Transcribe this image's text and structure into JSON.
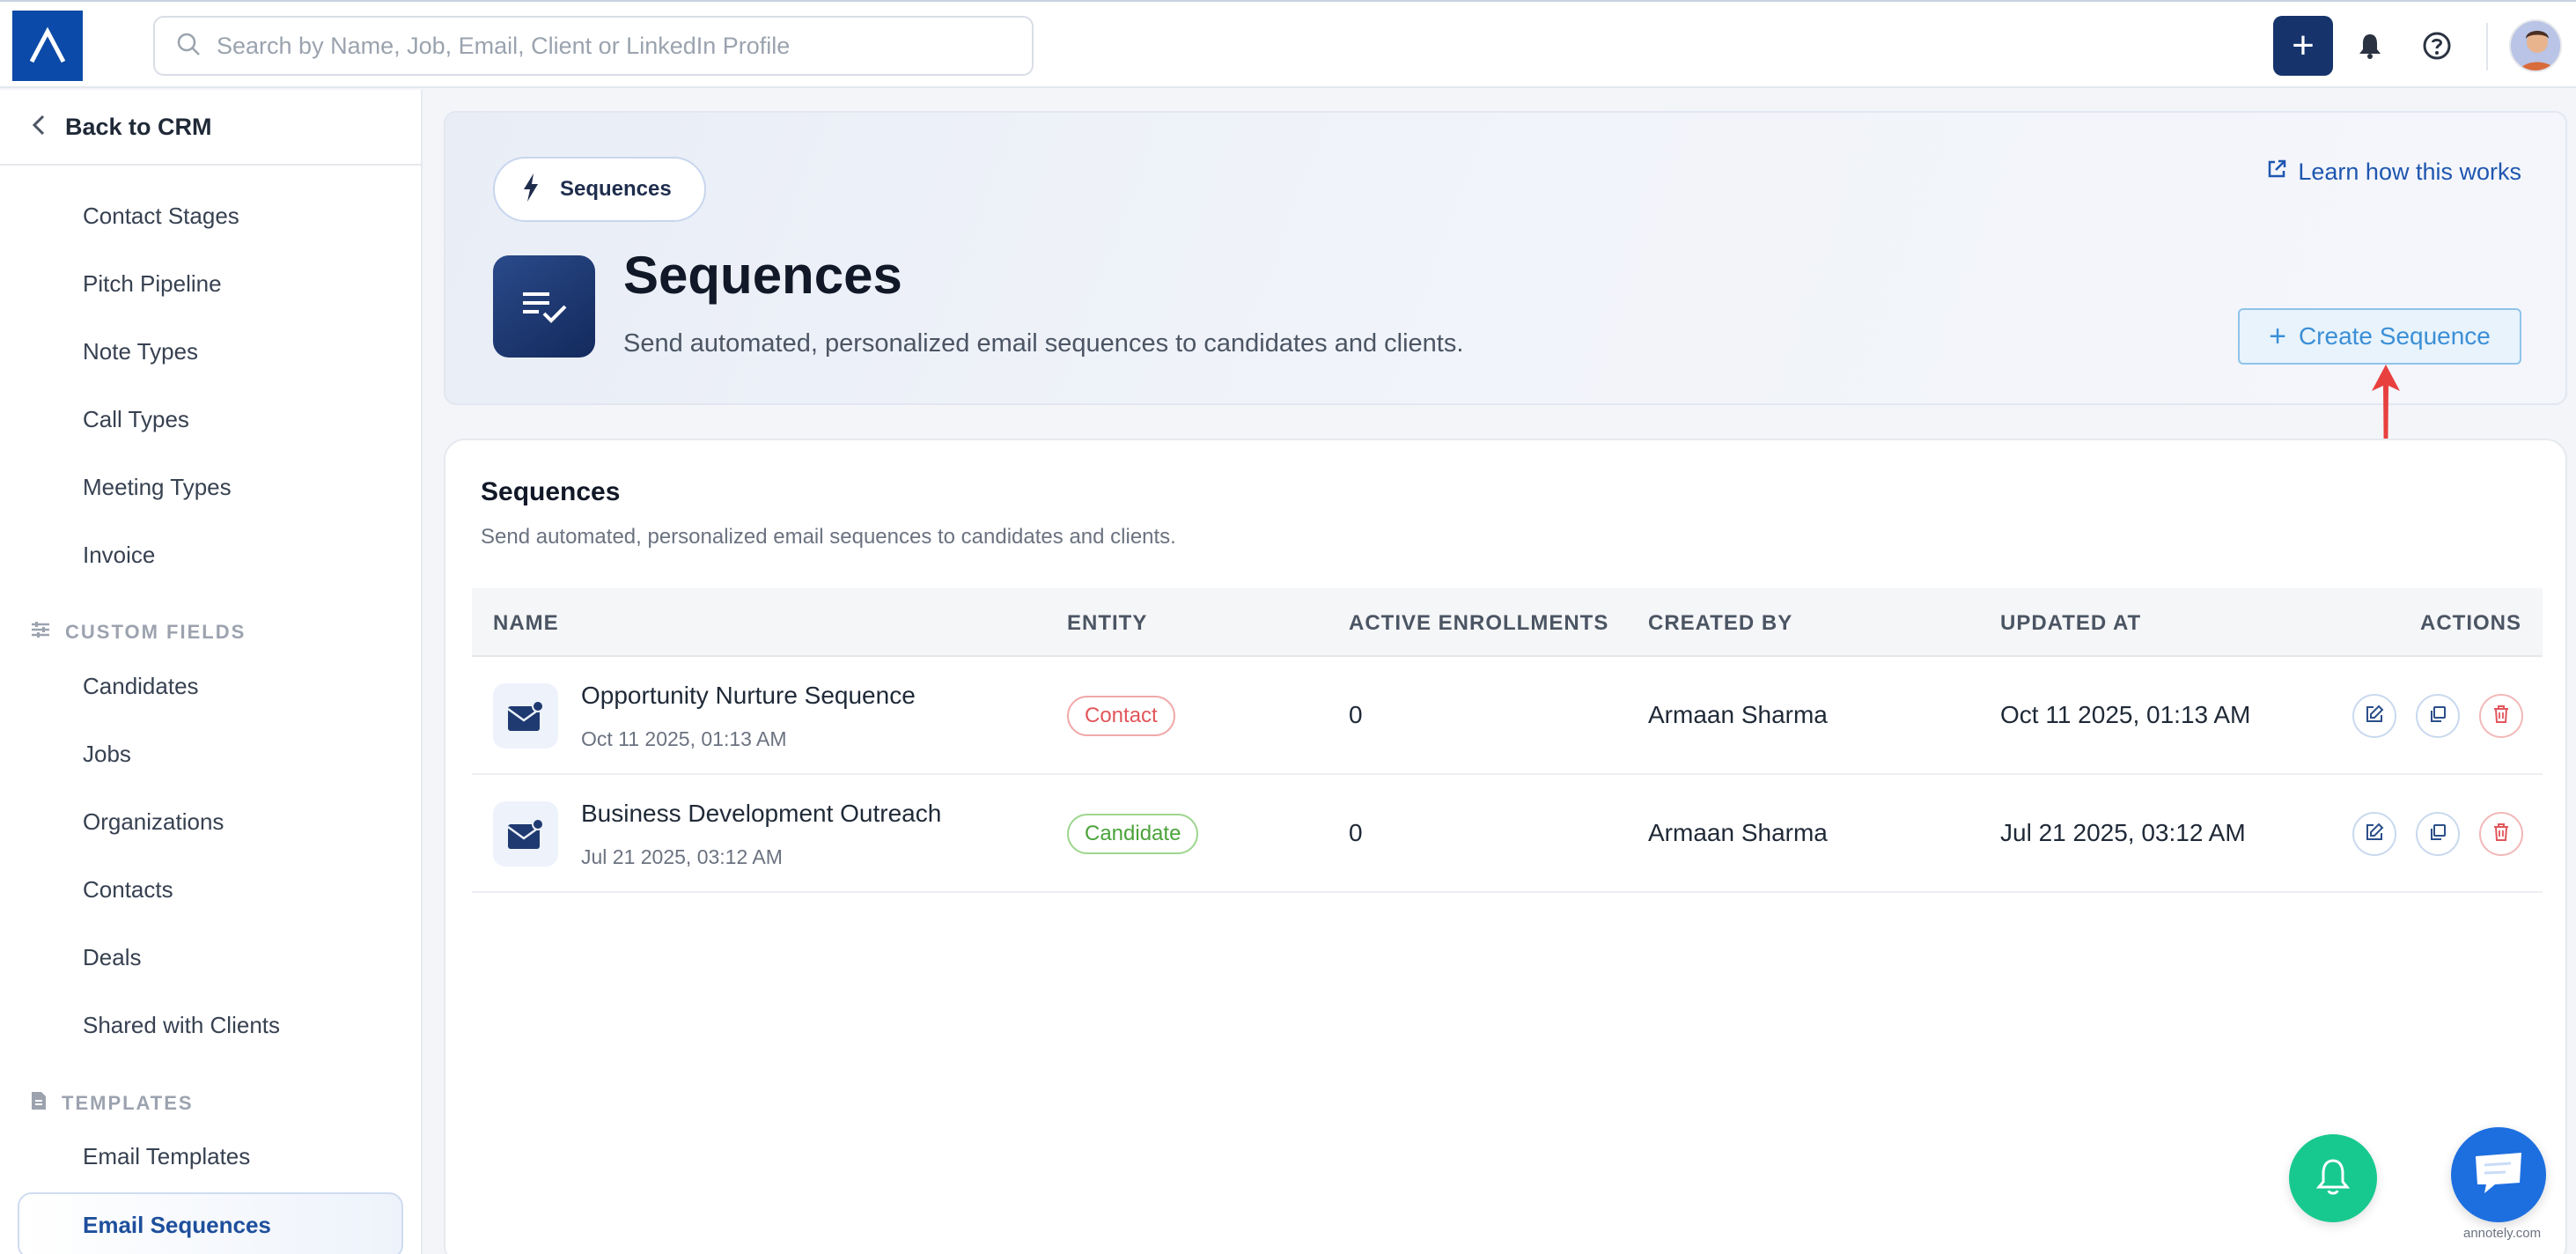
{
  "topbar": {
    "search_placeholder": "Search by Name, Job, Email, Client or LinkedIn Profile",
    "add_label": "+"
  },
  "sidebar": {
    "back_label": "Back to CRM",
    "items": [
      "Contact Stages",
      "Pitch Pipeline",
      "Note Types",
      "Call Types",
      "Meeting Types",
      "Invoice"
    ],
    "custom_fields_heading": "CUSTOM FIELDS",
    "custom_fields": [
      "Candidates",
      "Jobs",
      "Organizations",
      "Contacts",
      "Deals",
      "Shared with Clients"
    ],
    "templates_heading": "TEMPLATES",
    "templates": [
      "Email Templates",
      "Email Sequences"
    ]
  },
  "header": {
    "pill_label": "Sequences",
    "title": "Sequences",
    "subtitle": "Send automated, personalized email sequences to candidates and clients.",
    "learn_link": "Learn how this works",
    "create_button": "Create Sequence",
    "create_plus": "+"
  },
  "table": {
    "title": "Sequences",
    "subtitle": "Send automated, personalized email sequences to candidates and clients.",
    "columns": [
      "NAME",
      "ENTITY",
      "ACTIVE ENROLLMENTS",
      "CREATED BY",
      "UPDATED AT",
      "ACTIONS"
    ],
    "rows": [
      {
        "name": "Opportunity Nurture Sequence",
        "created": "Oct 11 2025, 01:13 AM",
        "entity": "Contact",
        "active_enrollments": "0",
        "created_by": "Armaan Sharma",
        "updated_at": "Oct 11 2025, 01:13 AM"
      },
      {
        "name": "Business Development Outreach",
        "created": "Jul 21 2025, 03:12 AM",
        "entity": "Candidate",
        "active_enrollments": "0",
        "created_by": "Armaan Sharma",
        "updated_at": "Jul 21 2025, 03:12 AM"
      }
    ]
  },
  "watermark": "annotely.com",
  "colors": {
    "brand_blue": "#0b4aa8",
    "navy": "#16346b",
    "accent_link": "#1e56b0",
    "create_button_text": "#3b8fd6",
    "contact_badge": "#e0565b",
    "candidate_badge": "#4aa33a",
    "bell_fab": "#18c98f",
    "chat_fab": "#1d6fe0",
    "annotation_arrow": "#e8403f"
  },
  "icons": {
    "logo": "logo-icon",
    "search": "search-icon",
    "bell": "bell-icon",
    "help": "help-circle-icon",
    "back": "chevron-left-icon",
    "custom_fields": "sliders-icon",
    "templates": "document-icon",
    "pill": "lightning-bolt-icon",
    "app": "list-check-icon",
    "learn": "external-link-icon",
    "row": "mail-user-icon",
    "edit": "edit-icon",
    "duplicate": "copy-icon",
    "delete": "trash-icon",
    "chat": "chat-icon"
  }
}
